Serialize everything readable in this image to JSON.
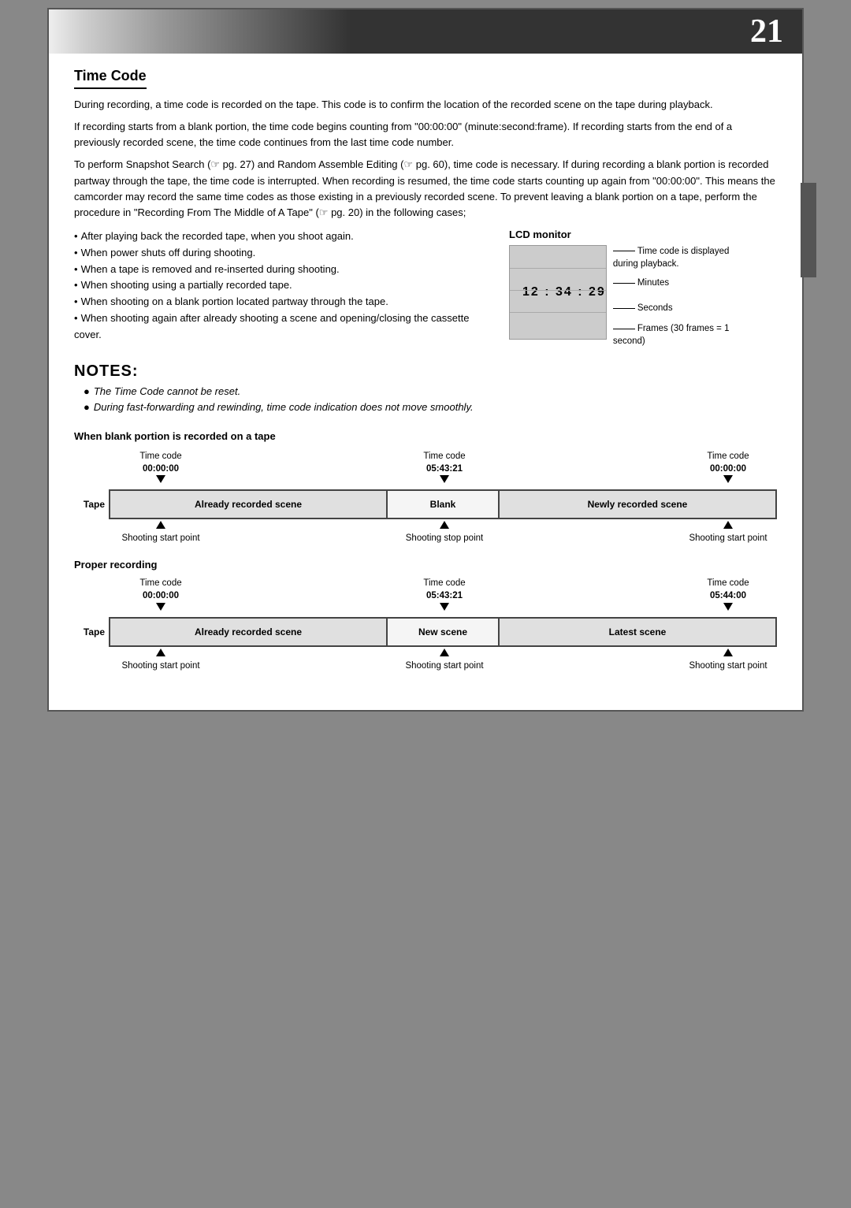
{
  "page": {
    "number": "21",
    "section_title": "Time Code",
    "paragraphs": [
      "During recording, a time code is recorded on the tape. This code is to confirm the location of the recorded scene on the tape during playback.",
      "If recording starts from a blank portion, the time code begins counting from \"00:00:00\" (minute:second:frame). If recording starts from the end of a previously recorded scene, the time code continues from the last time code number.",
      "To perform Snapshot Search (☞ pg. 27) and Random Assemble Editing (☞ pg. 60), time code is necessary. If during recording a blank portion is recorded partway through the tape, the time code is interrupted. When recording is resumed, the time code starts counting up again from \"00:00:00\". This means the camcorder may record the same time codes as those existing in a previously recorded scene. To prevent leaving a blank portion on a tape, perform the procedure in \"Recording From The Middle of A Tape\" (☞ pg. 20) in the following cases;"
    ],
    "bullet_points": [
      "After playing back the recorded tape, when you shoot again.",
      "When power shuts off during shooting.",
      "When a tape is removed and re-inserted during shooting.",
      "When shooting using a partially recorded tape.",
      "When shooting on a blank portion located partway through the tape.",
      "When shooting again after already shooting a scene and opening/closing the cassette cover."
    ],
    "lcd_monitor": {
      "label": "LCD monitor",
      "timecode_display": "12 : 34 : 29",
      "annotations": [
        "Time code is displayed during playback.",
        "Minutes",
        "Seconds",
        "Frames (30 frames = 1 second)"
      ]
    },
    "notes": {
      "title": "NOTES:",
      "items": [
        "The Time Code cannot be reset.",
        "During fast-forwarding and rewinding, time code indication does not move smoothly."
      ]
    },
    "blank_diagram": {
      "heading": "When blank portion is recorded on a tape",
      "timecodes": [
        {
          "label": "Time code",
          "value": "00:00:00",
          "position_pct": 5
        },
        {
          "label": "Time code",
          "value": "05:43:21",
          "position_pct": 38
        },
        {
          "label": "Time code",
          "value": "00:00:00",
          "position_pct": 66
        }
      ],
      "tape_label": "Tape",
      "segments": [
        {
          "text": "Already recorded scene",
          "type": "recorded",
          "flex": 2.5
        },
        {
          "text": "Blank",
          "type": "blank",
          "flex": 1
        },
        {
          "text": "Newly recorded scene",
          "type": "new",
          "flex": 2.5
        }
      ],
      "arrows": [
        {
          "label": "Shooting start point",
          "position_pct": 5,
          "direction": "down"
        },
        {
          "label": "Shooting stop point",
          "position_pct": 38,
          "direction": "down"
        },
        {
          "label": "Shooting start point",
          "position_pct": 66,
          "direction": "down"
        }
      ]
    },
    "proper_diagram": {
      "heading": "Proper recording",
      "timecodes": [
        {
          "label": "Time code",
          "value": "00:00:00",
          "position_pct": 5
        },
        {
          "label": "Time code",
          "value": "05:43:21",
          "position_pct": 38
        },
        {
          "label": "Time code",
          "value": "05:44:00",
          "position_pct": 66
        }
      ],
      "tape_label": "Tape",
      "segments": [
        {
          "text": "Already recorded scene",
          "type": "recorded",
          "flex": 2.5
        },
        {
          "text": "New scene",
          "type": "new_scene",
          "flex": 1
        },
        {
          "text": "Latest scene",
          "type": "latest",
          "flex": 2.5
        }
      ],
      "arrows": [
        {
          "label": "Shooting start point",
          "position_pct": 5,
          "direction": "down"
        },
        {
          "label": "Shooting start point",
          "position_pct": 38,
          "direction": "down"
        },
        {
          "label": "Shooting start point",
          "position_pct": 66,
          "direction": "down"
        }
      ]
    }
  }
}
